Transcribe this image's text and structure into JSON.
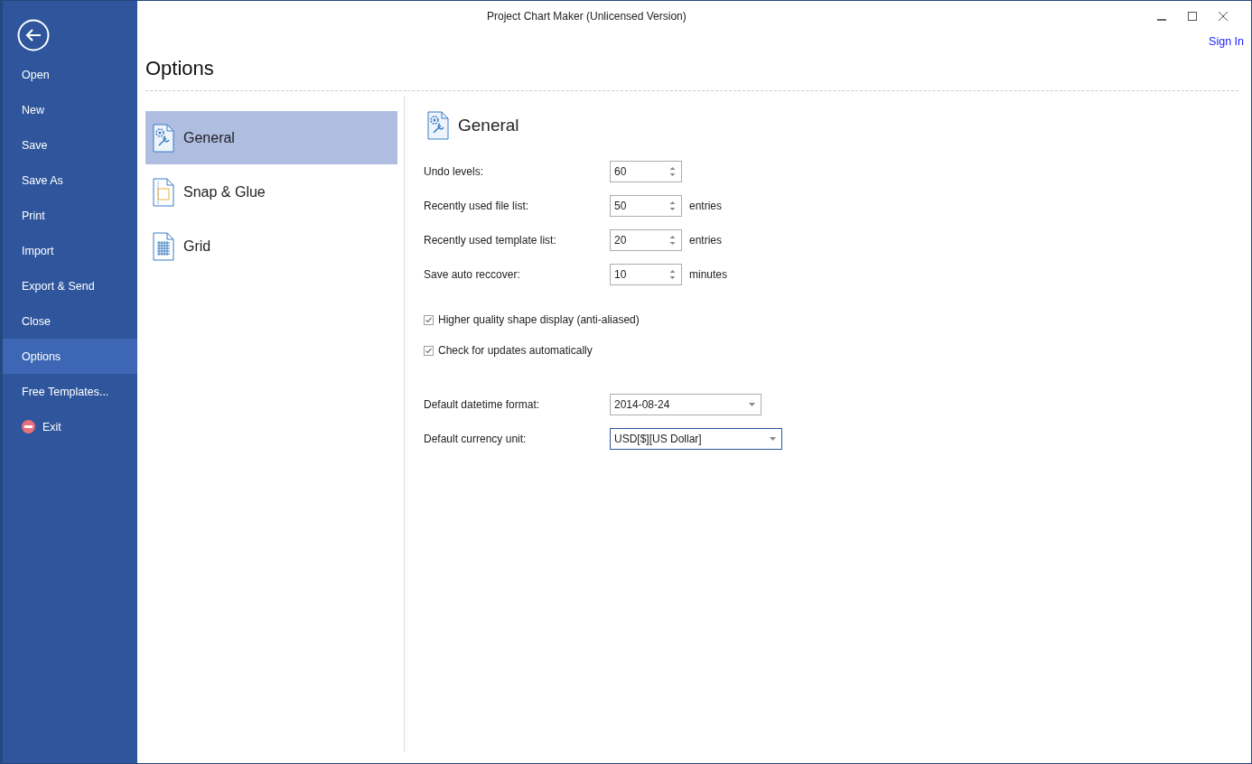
{
  "window": {
    "title": "Project Chart Maker (Unlicensed Version)",
    "sign_in": "Sign In"
  },
  "sidebar": {
    "items": [
      {
        "label": "Open",
        "selected": false,
        "kind": "text"
      },
      {
        "label": "New",
        "selected": false,
        "kind": "text"
      },
      {
        "label": "Save",
        "selected": false,
        "kind": "text"
      },
      {
        "label": "Save As",
        "selected": false,
        "kind": "text"
      },
      {
        "label": "Print",
        "selected": false,
        "kind": "text"
      },
      {
        "label": "Import",
        "selected": false,
        "kind": "text"
      },
      {
        "label": "Export & Send",
        "selected": false,
        "kind": "text"
      },
      {
        "label": "Close",
        "selected": false,
        "kind": "text"
      },
      {
        "label": "Options",
        "selected": true,
        "kind": "text"
      },
      {
        "label": "Free Templates...",
        "selected": false,
        "kind": "text"
      },
      {
        "label": "Exit",
        "selected": false,
        "kind": "exit"
      }
    ]
  },
  "page_title": "Options",
  "categories": [
    {
      "label": "General",
      "selected": true,
      "kind": "general"
    },
    {
      "label": "Snap & Glue",
      "selected": false,
      "kind": "snap"
    },
    {
      "label": "Grid",
      "selected": false,
      "kind": "grid"
    }
  ],
  "panel": {
    "title": "General",
    "spin_fields": [
      {
        "label": "Undo levels:",
        "value": "60"
      },
      {
        "label": "Recently used file list:",
        "value": "50",
        "unit": "entries"
      },
      {
        "label": "Recently used template list:",
        "value": "20",
        "unit": "entries"
      },
      {
        "label": "Save auto reccover:",
        "value": "10",
        "unit": "minutes"
      }
    ],
    "checkboxes": [
      {
        "label": "Higher quality shape display (anti-aliased)",
        "checked": true
      },
      {
        "label": "Check for updates automatically",
        "checked": true
      }
    ],
    "dropdowns": [
      {
        "label": "Default datetime format:",
        "value": "2014-08-24",
        "focused": false
      },
      {
        "label": "Default currency unit:",
        "value": "USD[$][US Dollar]",
        "focused": true
      }
    ]
  }
}
